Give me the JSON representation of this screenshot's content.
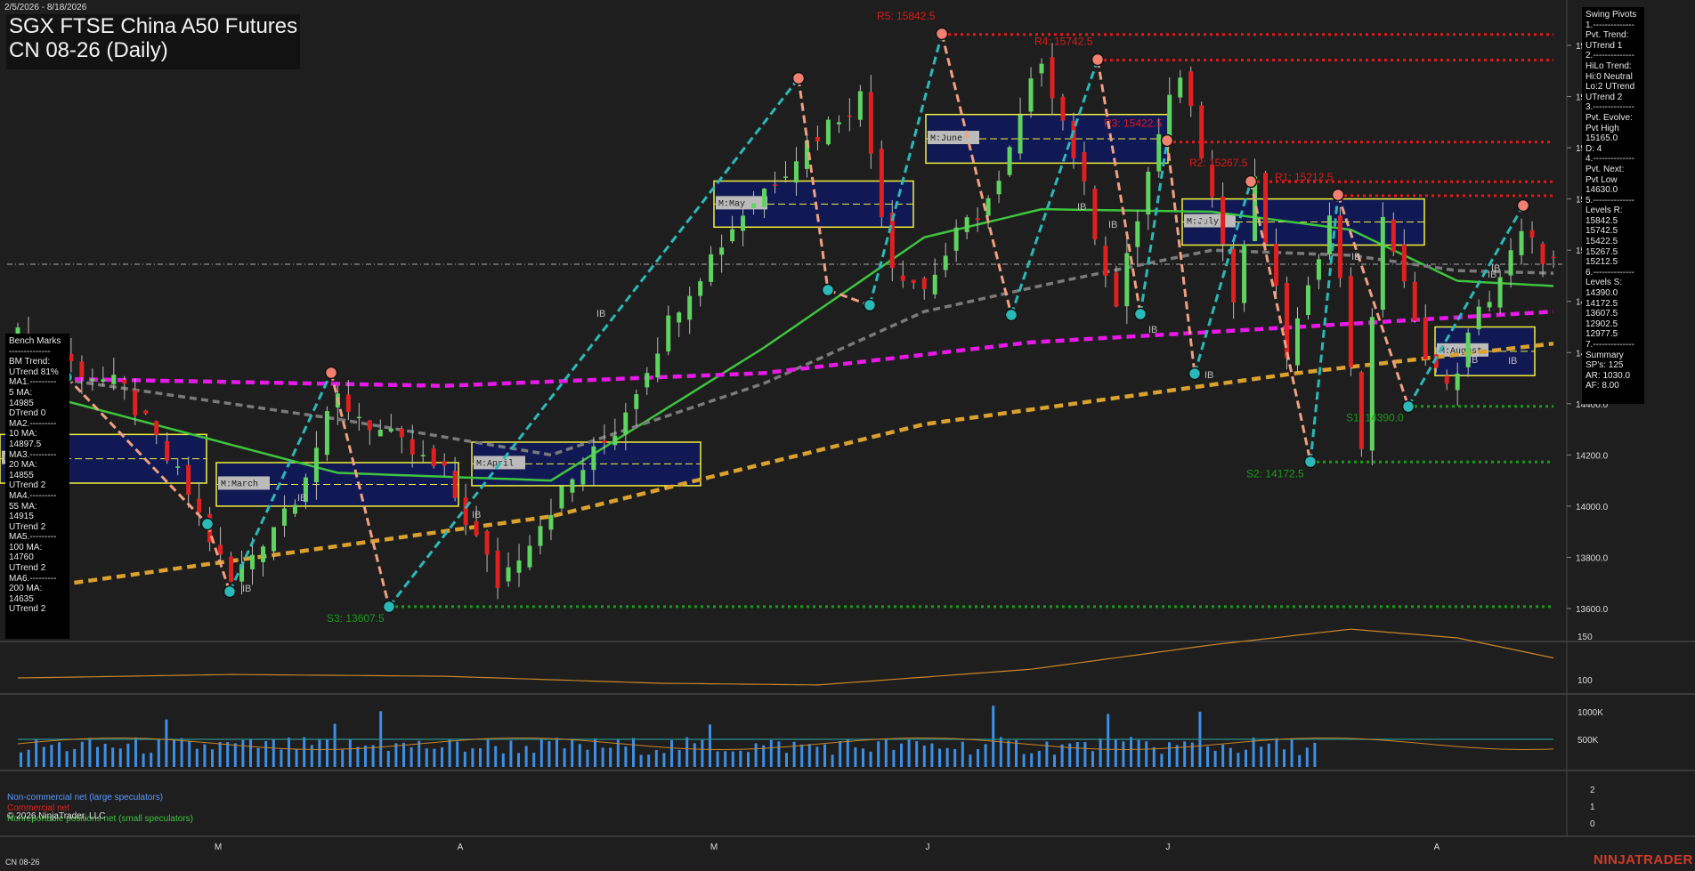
{
  "date_range": "2/5/2026 - 8/18/2026",
  "title_line1": "SGX FTSE China A50 Futures",
  "title_line2": "CN 08-26 (Daily)",
  "swing_pivots_panel": "Swing Pivots\n1.--------------\nPvt. Trend:\nUTrend 1\n2.--------------\nHiLo Trend:\nHi:0 Neutral\nLo:2 UTrend\nUTrend 2\n3.--------------\nPvt. Evolve:\nPvt High\n15165.0\nD: 4\n4.--------------\nPvt. Next:\nPvt Low\n14630.0\n5.--------------\nLevels R:\n15842.5\n15742.5\n15422.5\n15267.5\n15212.5\n6.--------------\nLevels S:\n14390.0\n14172.5\n13607.5\n12902.5\n12977.5\n7.--------------\nSummary\nSP's: 125\nAR: 1030.0\nAF: 8.00",
  "benchmarks_panel": "Bench Marks\n--------------\nBM Trend:\nUTrend 81%\nMA1.---------\n5 MA:\n14985\nDTrend 0\nMA2.---------\n10 MA:\n14897.5\nMA3.---------\n20 MA:\n14855\nUTrend 2\nMA4.---------\n55 MA:\n14915\nUTrend 2\nMA5.---------\n100 MA:\n14760\nUTrend 2\nMA6.---------\n200 MA:\n14635\nUTrend 2",
  "legend": {
    "noncommercial": "Non-commercial net (large speculators)",
    "commercial": "Commercial net",
    "nonreportable": "Nonreportable positions net (small speculators)"
  },
  "copyright": "© 2026 NinjaTrader, LLC",
  "footer_symbol": "CN 08-26",
  "brand": "NINJATRADER",
  "colors": {
    "background": "#1e1e1e",
    "up_candle": "#5fd35f",
    "down_candle": "#e02020",
    "resistance": "#e01818",
    "support": "#1a9a1a",
    "ma_green": "#3ec43e",
    "ma_gray": "#7a7a7a",
    "ma_magenta": "#e619e6",
    "ma_orange": "#dba12e",
    "swing_up": "#2bb8b8",
    "swing_down": "#f0a080",
    "volume": "#3c8fe6",
    "month_box_fill": "#10185a",
    "month_box_border": "#f0f03c"
  },
  "chart_data": [
    {
      "type": "candlestick",
      "title": "SGX FTSE China A50 Futures CN 08-26 (Daily)",
      "x_labels": [
        "M",
        "A",
        "M",
        "J",
        "J",
        "A"
      ],
      "y_ticks": [
        13600,
        13800,
        14000,
        14200,
        14400,
        14600,
        14800,
        15000,
        15200,
        15400,
        15600,
        15800
      ],
      "ylim": [
        13480,
        15920
      ],
      "n_bars": 135,
      "close_anchors": [
        [
          0,
          14660
        ],
        [
          10,
          14450
        ],
        [
          16,
          14050
        ],
        [
          20,
          13700
        ],
        [
          26,
          14050
        ],
        [
          30,
          14420
        ],
        [
          35,
          14260
        ],
        [
          40,
          14120
        ],
        [
          45,
          13700
        ],
        [
          50,
          14000
        ],
        [
          56,
          14300
        ],
        [
          62,
          14800
        ],
        [
          68,
          15150
        ],
        [
          74,
          15420
        ],
        [
          79,
          15600
        ],
        [
          82,
          14950
        ],
        [
          85,
          14850
        ],
        [
          88,
          15050
        ],
        [
          92,
          15250
        ],
        [
          96,
          15760
        ],
        [
          99,
          15380
        ],
        [
          103,
          14780
        ],
        [
          106,
          15300
        ],
        [
          109,
          15700
        ],
        [
          112,
          15250
        ],
        [
          114,
          14800
        ],
        [
          116,
          15250
        ],
        [
          119,
          14600
        ],
        [
          121,
          14820
        ],
        [
          123,
          15180
        ],
        [
          126,
          14250
        ],
        [
          128,
          15150
        ],
        [
          131,
          14700
        ],
        [
          134,
          14450
        ],
        [
          137,
          14750
        ],
        [
          141,
          15050
        ],
        [
          144,
          14950
        ]
      ],
      "annotations": [
        {
          "label": "R5: 15842.5",
          "value": 15842.5,
          "kind": "resistance"
        },
        {
          "label": "R4: 15742.5",
          "value": 15742.5,
          "kind": "resistance"
        },
        {
          "label": "R3: 15422.5",
          "value": 15422.5,
          "kind": "resistance"
        },
        {
          "label": "R2: 15267.5",
          "value": 15267.5,
          "kind": "resistance"
        },
        {
          "label": "R1: 15212.5",
          "value": 15212.5,
          "kind": "resistance"
        },
        {
          "label": "S1: 14390.0",
          "value": 14390.0,
          "kind": "support"
        },
        {
          "label": "S2: 14172.5",
          "value": 14172.5,
          "kind": "support"
        },
        {
          "label": "S3: 13607.5",
          "value": 13607.5,
          "kind": "support"
        }
      ],
      "month_boxes": [
        {
          "label": "February",
          "hi": 14280,
          "lo": 14090
        },
        {
          "label": "March",
          "hi": 14170,
          "lo": 14000
        },
        {
          "label": "April",
          "hi": 14250,
          "lo": 14080
        },
        {
          "label": "May",
          "hi": 15270,
          "lo": 15090
        },
        {
          "label": "June",
          "hi": 15530,
          "lo": 15340
        },
        {
          "label": "July",
          "hi": 15200,
          "lo": 15020
        },
        {
          "label": "August",
          "hi": 14700,
          "lo": 14510
        }
      ],
      "moving_averages": [
        {
          "name": "20 MA",
          "anchors": [
            [
              0,
              14460
            ],
            [
              30,
              14130
            ],
            [
              50,
              14100
            ],
            [
              70,
              14620
            ],
            [
              85,
              15050
            ],
            [
              96,
              15160
            ],
            [
              112,
              15150
            ],
            [
              125,
              15080
            ],
            [
              135,
              14880
            ],
            [
              144,
              14860
            ]
          ]
        },
        {
          "name": "55 MA",
          "anchors": [
            [
              0,
              14520
            ],
            [
              30,
              14340
            ],
            [
              50,
              14200
            ],
            [
              70,
              14480
            ],
            [
              85,
              14760
            ],
            [
              98,
              14880
            ],
            [
              112,
              15000
            ],
            [
              125,
              14980
            ],
            [
              135,
              14920
            ],
            [
              144,
              14910
            ]
          ]
        },
        {
          "name": "100 MA",
          "anchors": [
            [
              0,
              14500
            ],
            [
              40,
              14470
            ],
            [
              70,
              14520
            ],
            [
              95,
              14640
            ],
            [
              120,
              14700
            ],
            [
              144,
              14760
            ]
          ]
        },
        {
          "name": "200 MA",
          "anchors": [
            [
              0,
              13670
            ],
            [
              50,
              13960
            ],
            [
              85,
              14320
            ],
            [
              120,
              14520
            ],
            [
              144,
              14635
            ]
          ]
        }
      ],
      "ib_labels": [
        "IB",
        "IB",
        "IB",
        "IB",
        "IB",
        "IB",
        "IB",
        "IB",
        "IB",
        "IB",
        "IB",
        "IB",
        "IB",
        "IB"
      ]
    },
    {
      "type": "line",
      "name": "oscillator",
      "y_ticks": [
        100,
        150
      ],
      "anchors": [
        [
          0,
          102
        ],
        [
          20,
          106
        ],
        [
          40,
          104
        ],
        [
          60,
          96
        ],
        [
          75,
          94
        ],
        [
          95,
          112
        ],
        [
          112,
          140
        ],
        [
          125,
          158
        ],
        [
          135,
          148
        ],
        [
          144,
          125
        ]
      ]
    },
    {
      "type": "bar",
      "name": "volume",
      "y_ticks": [
        "500K",
        "1000K"
      ],
      "ma_level": 500000,
      "spikes": [
        [
          19,
          860000
        ],
        [
          41,
          780000
        ],
        [
          47,
          1010000
        ],
        [
          90,
          770000
        ],
        [
          127,
          1110000
        ],
        [
          142,
          960000
        ],
        [
          154,
          1000000
        ]
      ],
      "base": 420000
    },
    {
      "type": "line",
      "name": "commitments of traders",
      "y_ticks": [
        0,
        1,
        2
      ],
      "series": [
        "Non-commercial net (large speculators)",
        "Commercial net",
        "Nonreportable positions net (small speculators)"
      ]
    }
  ]
}
